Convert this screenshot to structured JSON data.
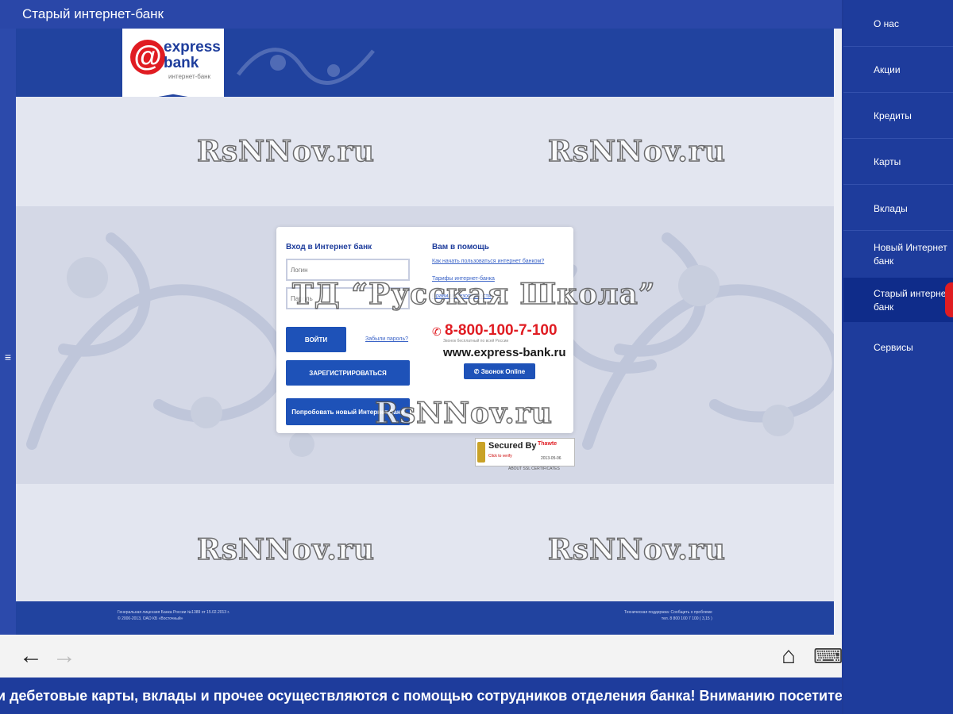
{
  "titlebar": {
    "title": "Старый интернет-банк"
  },
  "rightnav": {
    "items": [
      {
        "label": "О нас"
      },
      {
        "label": "Акции"
      },
      {
        "label": "Кредиты"
      },
      {
        "label": "Карты"
      },
      {
        "label": "Вклады"
      },
      {
        "label": "Новый Интернет банк"
      },
      {
        "label": "Старый интернет банк",
        "active": true
      },
      {
        "label": "Сервисы"
      }
    ]
  },
  "logo": {
    "line1": "express",
    "line2": "bank",
    "sub": "интернет-банк",
    "at_symbol": "@"
  },
  "login": {
    "heading": "Вход в Интернет банк",
    "login_placeholder": "Логин",
    "password_placeholder": "Пароль",
    "login_button": "ВОЙТИ",
    "forgot_link": "Забыли пароль?",
    "register_button": "ЗАРЕГИСТРИРОВАТЬСЯ",
    "try_new_button": "Попробовать новый Интернет банк"
  },
  "help": {
    "heading": "Вам в помощь",
    "links": [
      "Как начать пользоваться интернет банком?",
      "Тарифы интернет-банка",
      "Правила безопасности"
    ],
    "phone": "8-800-100-7-100",
    "phone_sub": "Звонок бесплатный по всей России",
    "site": "www.express-bank.ru",
    "call_button": "Звонок Online"
  },
  "secured": {
    "text": "Secured By",
    "brand": "Thawte",
    "small": "Click to verify",
    "date": "2013-05-06",
    "about": "ABOUT SSL CERTIFICATES"
  },
  "footer": {
    "left_line1": "Генеральная лицензия Банка России №1389 от 15.02.2013 г.",
    "left_line2": "© 2000-2013, ОАО КБ «Восточный»",
    "right_line1": "Техническая поддержка: Сообщить о проблеме",
    "right_line2": "тел. 8 800 100 7 100 ( 3,15 )"
  },
  "toolbar": {
    "back_icon": "←",
    "forward_icon": "→",
    "home_icon": "⌂",
    "keyboard_icon": "⌨"
  },
  "ticker": {
    "text": "и дебетовые карты, вклады и прочее осуществляются с помощью сотрудников отделения банка!  Вниманию посетителей банка"
  },
  "watermarks": {
    "site": "RsNNov.ru",
    "school": "ТД “Русская Школа”"
  },
  "colors": {
    "brand_blue": "#1e3c9c",
    "accent_red": "#e01c22",
    "button_blue": "#1e52b8"
  }
}
